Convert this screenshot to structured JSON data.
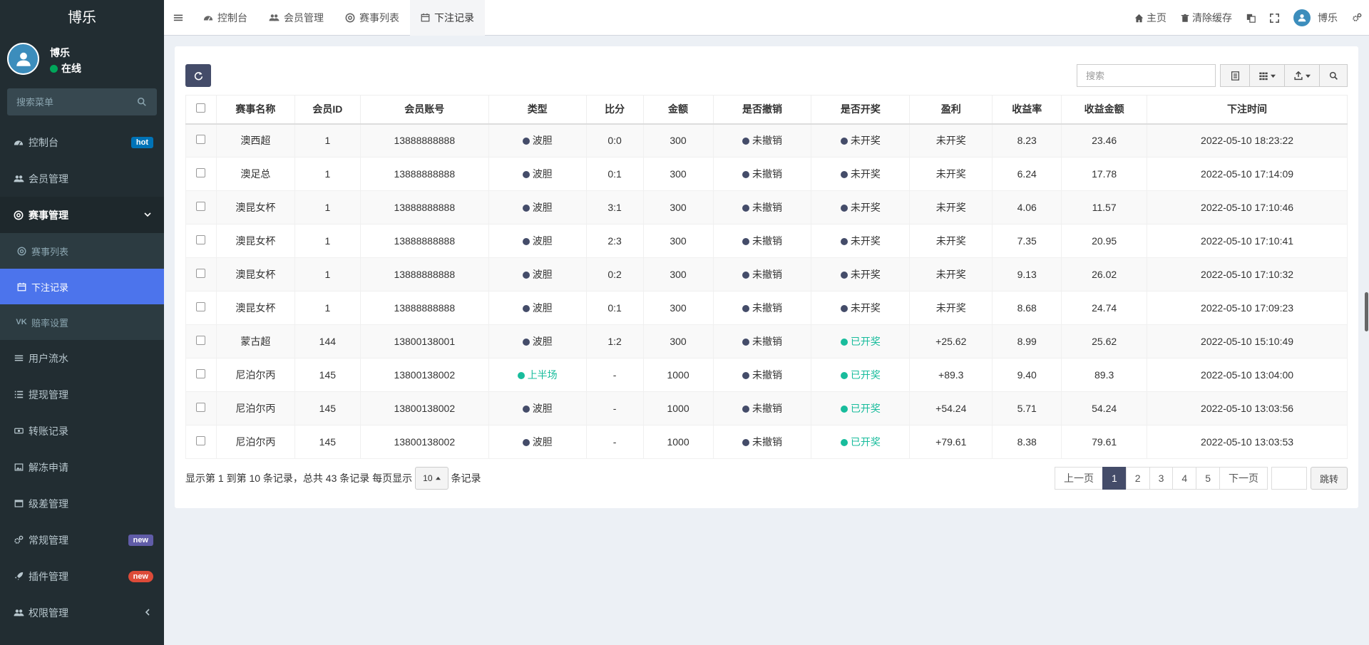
{
  "sidebar": {
    "logo": "博乐",
    "user": {
      "name": "博乐",
      "status": "在线"
    },
    "search_placeholder": "搜索菜单",
    "items": [
      {
        "label": "控制台",
        "badge": "hot"
      },
      {
        "label": "会员管理"
      },
      {
        "label": "赛事管理"
      },
      {
        "label": "用户流水"
      },
      {
        "label": "提现管理"
      },
      {
        "label": "转账记录"
      },
      {
        "label": "解冻申请"
      },
      {
        "label": "级差管理"
      },
      {
        "label": "常规管理",
        "badge": "new"
      },
      {
        "label": "插件管理",
        "badge": "new"
      },
      {
        "label": "权限管理"
      }
    ],
    "submenu": [
      {
        "label": "赛事列表"
      },
      {
        "label": "下注记录"
      },
      {
        "label": "赔率设置"
      }
    ]
  },
  "header": {
    "tabs": [
      {
        "label": "控制台"
      },
      {
        "label": "会员管理"
      },
      {
        "label": "赛事列表"
      },
      {
        "label": "下注记录"
      }
    ],
    "right": {
      "home": "主页",
      "clear_cache": "清除缓存",
      "user": "博乐"
    }
  },
  "toolbar": {
    "search_placeholder": "搜索"
  },
  "table": {
    "columns": [
      "赛事名称",
      "会员ID",
      "会员账号",
      "类型",
      "比分",
      "金额",
      "是否撤销",
      "是否开奖",
      "盈利",
      "收益率",
      "收益金额",
      "下注时间"
    ],
    "rows": [
      {
        "name": "澳西超",
        "member_id": "1",
        "account": "13888888888",
        "type": "波胆",
        "score": "0:0",
        "amount": "300",
        "revoked": "未撤销",
        "drawn": "未开奖",
        "profit": "未开奖",
        "rate": "8.23",
        "income": "23.46",
        "time": "2022-05-10 18:23:22"
      },
      {
        "name": "澳足总",
        "member_id": "1",
        "account": "13888888888",
        "type": "波胆",
        "score": "0:1",
        "amount": "300",
        "revoked": "未撤销",
        "drawn": "未开奖",
        "profit": "未开奖",
        "rate": "6.24",
        "income": "17.78",
        "time": "2022-05-10 17:14:09"
      },
      {
        "name": "澳昆女杯",
        "member_id": "1",
        "account": "13888888888",
        "type": "波胆",
        "score": "3:1",
        "amount": "300",
        "revoked": "未撤销",
        "drawn": "未开奖",
        "profit": "未开奖",
        "rate": "4.06",
        "income": "11.57",
        "time": "2022-05-10 17:10:46"
      },
      {
        "name": "澳昆女杯",
        "member_id": "1",
        "account": "13888888888",
        "type": "波胆",
        "score": "2:3",
        "amount": "300",
        "revoked": "未撤销",
        "drawn": "未开奖",
        "profit": "未开奖",
        "rate": "7.35",
        "income": "20.95",
        "time": "2022-05-10 17:10:41"
      },
      {
        "name": "澳昆女杯",
        "member_id": "1",
        "account": "13888888888",
        "type": "波胆",
        "score": "0:2",
        "amount": "300",
        "revoked": "未撤销",
        "drawn": "未开奖",
        "profit": "未开奖",
        "rate": "9.13",
        "income": "26.02",
        "time": "2022-05-10 17:10:32"
      },
      {
        "name": "澳昆女杯",
        "member_id": "1",
        "account": "13888888888",
        "type": "波胆",
        "score": "0:1",
        "amount": "300",
        "revoked": "未撤销",
        "drawn": "未开奖",
        "profit": "未开奖",
        "rate": "8.68",
        "income": "24.74",
        "time": "2022-05-10 17:09:23"
      },
      {
        "name": "蒙古超",
        "member_id": "144",
        "account": "13800138001",
        "type": "波胆",
        "score": "1:2",
        "amount": "300",
        "revoked": "未撤销",
        "drawn": "已开奖",
        "profit": "+25.62",
        "rate": "8.99",
        "income": "25.62",
        "time": "2022-05-10 15:10:49"
      },
      {
        "name": "尼泊尔丙",
        "member_id": "145",
        "account": "13800138002",
        "type": "上半场",
        "score": "-",
        "amount": "1000",
        "revoked": "未撤销",
        "drawn": "已开奖",
        "profit": "+89.3",
        "rate": "9.40",
        "income": "89.3",
        "time": "2022-05-10 13:04:00"
      },
      {
        "name": "尼泊尔丙",
        "member_id": "145",
        "account": "13800138002",
        "type": "波胆",
        "score": "-",
        "amount": "1000",
        "revoked": "未撤销",
        "drawn": "已开奖",
        "profit": "+54.24",
        "rate": "5.71",
        "income": "54.24",
        "time": "2022-05-10 13:03:56"
      },
      {
        "name": "尼泊尔丙",
        "member_id": "145",
        "account": "13800138002",
        "type": "波胆",
        "score": "-",
        "amount": "1000",
        "revoked": "未撤销",
        "drawn": "已开奖",
        "profit": "+79.61",
        "rate": "8.38",
        "income": "79.61",
        "time": "2022-05-10 13:03:53"
      }
    ]
  },
  "footer": {
    "info_prefix": "显示第 1 到第 10 条记录，总共 43 条记录 每页显示",
    "page_size": "10",
    "info_suffix": "条记录",
    "prev": "上一页",
    "pages": [
      "1",
      "2",
      "3",
      "4",
      "5"
    ],
    "next": "下一页",
    "jump": "跳转"
  },
  "colors": {
    "accent": "#444c69",
    "active_menu": "#4c74ec",
    "green": "#18bc9c",
    "sidebar_bg": "#222d32"
  }
}
